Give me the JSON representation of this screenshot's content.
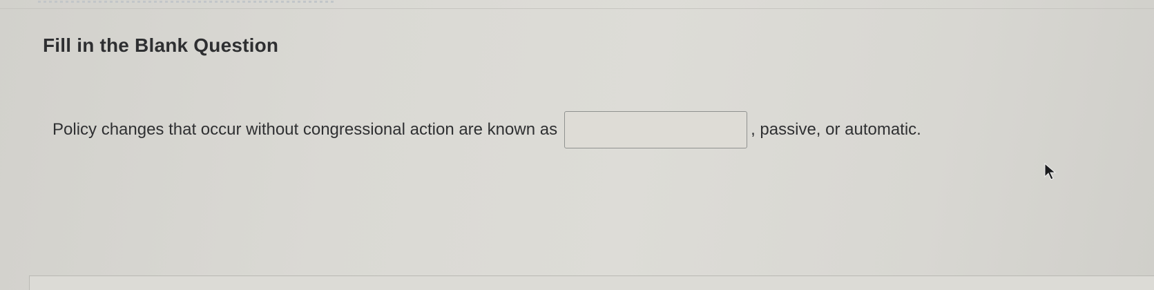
{
  "question": {
    "heading": "Fill in the Blank Question",
    "text_before": "Policy changes that occur without congressional action are known as",
    "answer_value": "",
    "text_after": ", passive, or automatic."
  },
  "icons": {
    "cursor": "mouse-pointer-icon"
  },
  "colors": {
    "background": "#d9d8d3",
    "text": "#2e2f31",
    "input_border": "#8f918f"
  }
}
